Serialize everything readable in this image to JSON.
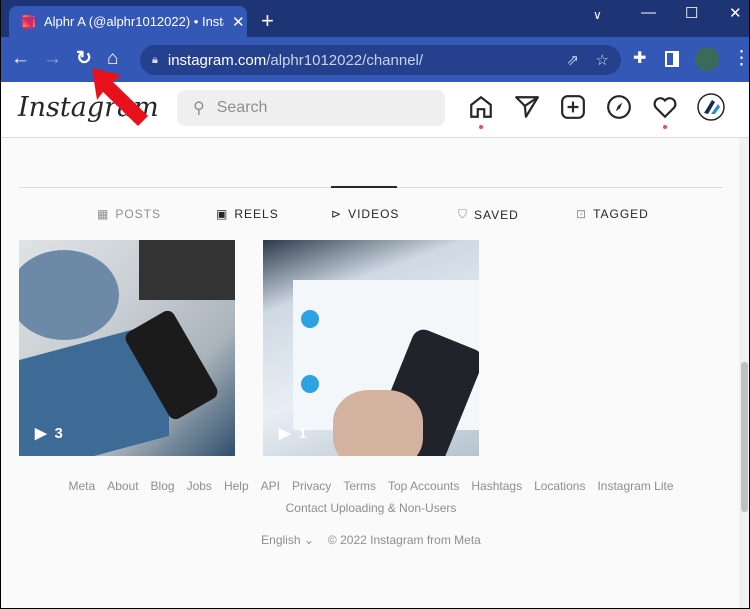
{
  "browser": {
    "tab_title": "Alphr A (@alphr1012022) • Instagram",
    "url_host": "instagram.com",
    "url_path": "/alphr1012022/channel/"
  },
  "instagram": {
    "logo": "Instagram",
    "search_placeholder": "Search",
    "tabs": [
      {
        "label": "POSTS",
        "icon": "grid-icon"
      },
      {
        "label": "REELS",
        "icon": "reels-icon"
      },
      {
        "label": "VIDEOS",
        "icon": "play-circle-icon",
        "active": true
      },
      {
        "label": "SAVED",
        "icon": "bookmark-icon"
      },
      {
        "label": "TAGGED",
        "icon": "tagged-icon"
      }
    ],
    "videos": [
      {
        "views": "3"
      },
      {
        "views": "1"
      }
    ]
  },
  "footer": {
    "links": [
      "Meta",
      "About",
      "Blog",
      "Jobs",
      "Help",
      "API",
      "Privacy",
      "Terms",
      "Top Accounts",
      "Hashtags",
      "Locations",
      "Instagram Lite"
    ],
    "link2": "Contact Uploading & Non-Users",
    "language": "English",
    "copyright": "© 2022 Instagram from Meta"
  },
  "colors": {
    "accent": "#3358b6",
    "notify": "#ed4956",
    "arrow": "#e8101a"
  }
}
